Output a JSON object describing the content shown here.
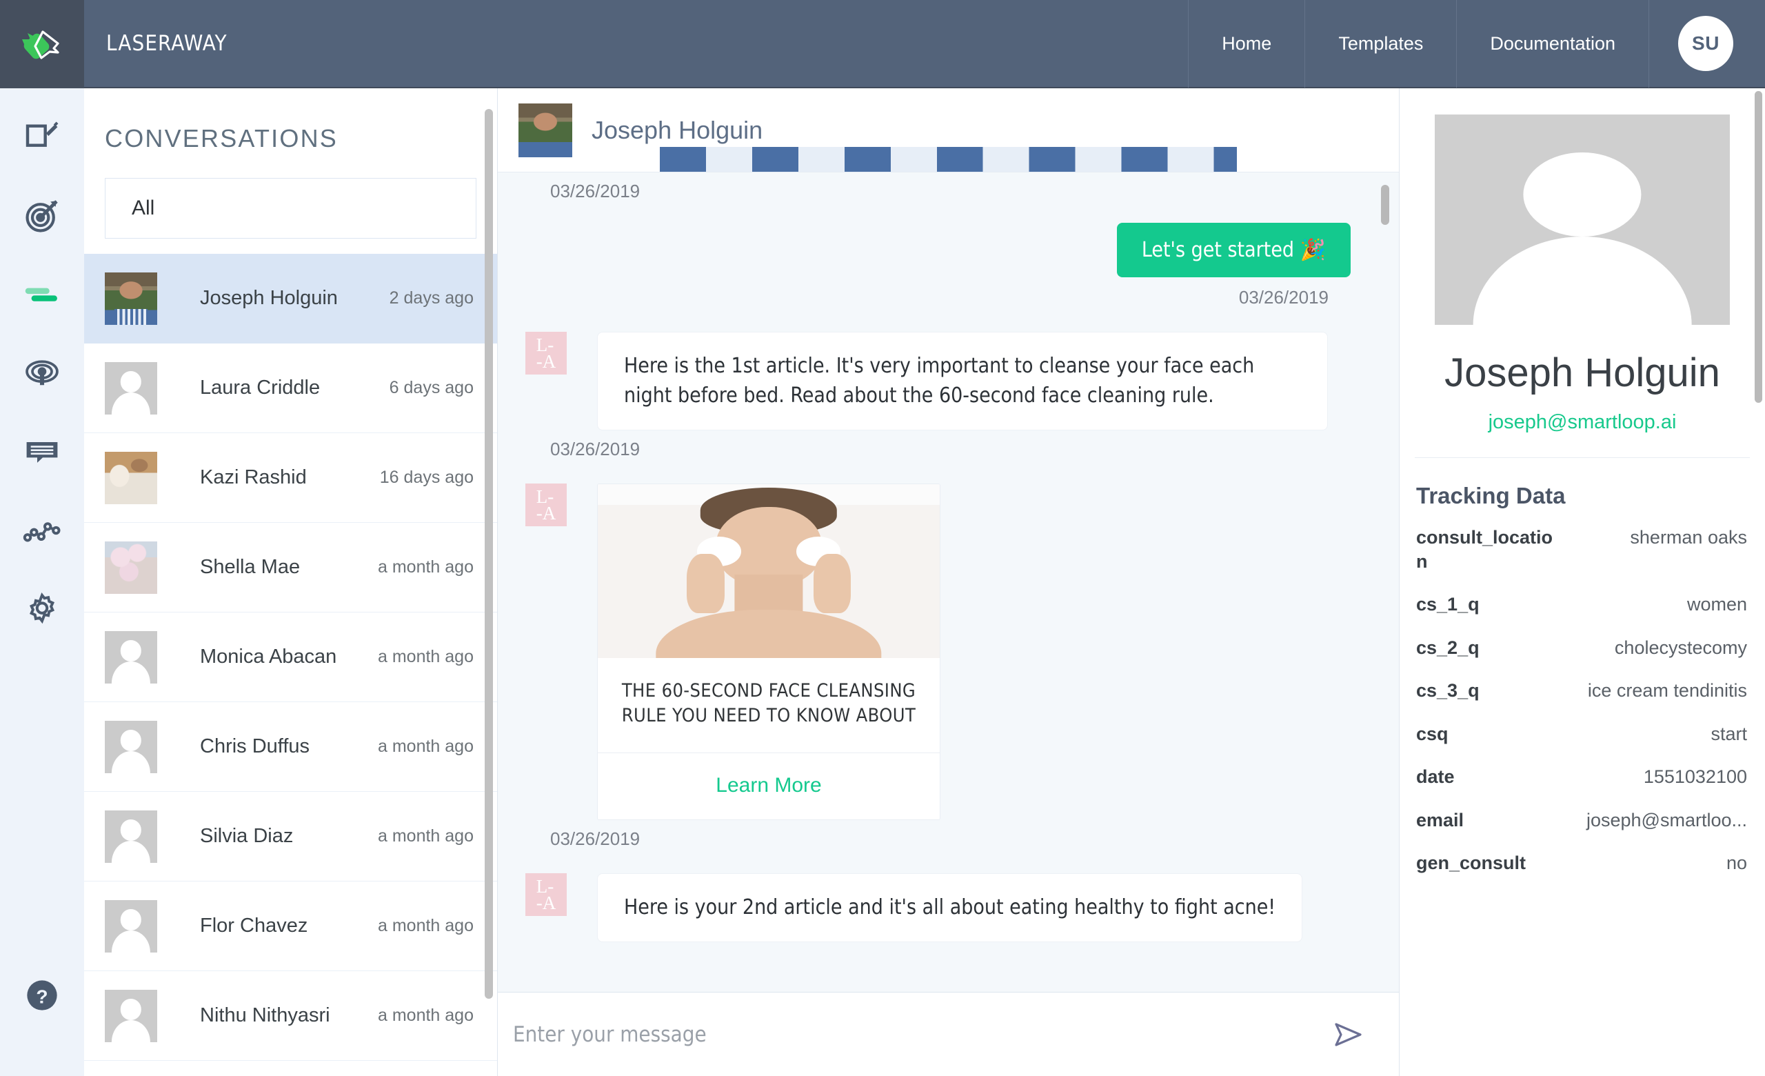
{
  "brand": {
    "name": "LASERAWAY",
    "logo_icon": "smartloop-chat-logo"
  },
  "topnav": {
    "items": [
      {
        "label": "Home"
      },
      {
        "label": "Templates"
      },
      {
        "label": "Documentation"
      }
    ],
    "avatar_initials": "SU"
  },
  "rail": {
    "items": [
      {
        "name": "compose-icon"
      },
      {
        "name": "target-icon"
      },
      {
        "name": "chat-bubbles-icon"
      },
      {
        "name": "broadcast-icon"
      },
      {
        "name": "messages-icon"
      },
      {
        "name": "analytics-icon"
      },
      {
        "name": "settings-gear-icon"
      }
    ],
    "help_icon": "help-question-icon"
  },
  "conversations": {
    "title": "CONVERSATIONS",
    "filter_value": "All",
    "items": [
      {
        "name": "Joseph Holguin",
        "time": "2 days ago",
        "avatar": "photo-joseph",
        "active": true
      },
      {
        "name": "Laura Criddle",
        "time": "6 days ago",
        "avatar": "placeholder",
        "active": false
      },
      {
        "name": "Kazi Rashid",
        "time": "16 days ago",
        "avatar": "photo-kazi",
        "active": false
      },
      {
        "name": "Shella Mae",
        "time": "a month ago",
        "avatar": "photo-shella",
        "active": false
      },
      {
        "name": "Monica Abacan",
        "time": "a month ago",
        "avatar": "placeholder",
        "active": false
      },
      {
        "name": "Chris Duffus",
        "time": "a month ago",
        "avatar": "placeholder",
        "active": false
      },
      {
        "name": "Silvia Diaz",
        "time": "a month ago",
        "avatar": "placeholder",
        "active": false
      },
      {
        "name": "Flor Chavez",
        "time": "a month ago",
        "avatar": "placeholder",
        "active": false
      },
      {
        "name": "Nithu Nithyasri",
        "time": "a month ago",
        "avatar": "placeholder",
        "active": false
      }
    ]
  },
  "chat": {
    "header_name": "Joseph Holguin",
    "top_clipped_date": "03/26/2019",
    "messages": [
      {
        "kind": "outgoing-button",
        "text": "Let's get started 🎉",
        "date": "03/26/2019"
      },
      {
        "kind": "incoming-text",
        "text": "Here is the 1st article. It's very important to cleanse your face each night before bed. Read about the 60-second face cleaning rule.",
        "date": "03/26/2019"
      },
      {
        "kind": "incoming-card",
        "card_title": "THE 60-SECOND FACE CLEANSING RULE YOU NEED TO KNOW ABOUT",
        "card_cta": "Learn More",
        "date": "03/26/2019"
      },
      {
        "kind": "incoming-text",
        "text": "Here is your 2nd article and it's all about eating healthy to fight acne!",
        "date": ""
      }
    ],
    "bot_avatar_line1": "L-",
    "bot_avatar_line2": "-A",
    "composer_placeholder": "Enter your message",
    "send_icon": "send-paper-plane-icon"
  },
  "profile": {
    "photo_icon": "default-user-photo",
    "name": "Joseph Holguin",
    "email": "joseph@smartloop.ai",
    "tracking_title": "Tracking Data",
    "tracking": [
      {
        "key": "consult_location",
        "value": "sherman oaks"
      },
      {
        "key": "cs_1_q",
        "value": "women"
      },
      {
        "key": "cs_2_q",
        "value": "cholecystecomy"
      },
      {
        "key": "cs_3_q",
        "value": "ice cream tendinitis"
      },
      {
        "key": "csq",
        "value": "start"
      },
      {
        "key": "date",
        "value": "1551032100"
      },
      {
        "key": "email",
        "value": "joseph@smartloo..."
      },
      {
        "key": "gen_consult",
        "value": "no"
      }
    ]
  },
  "colors": {
    "topbar": "#53637a",
    "logo_cell": "#454f5e",
    "accent_green": "#14c98e",
    "rail_bg": "#eef3fa",
    "active_row": "#d9e5f5",
    "chat_bg": "#f4f8fb",
    "bot_avatar_pink": "#f2cfd5"
  }
}
